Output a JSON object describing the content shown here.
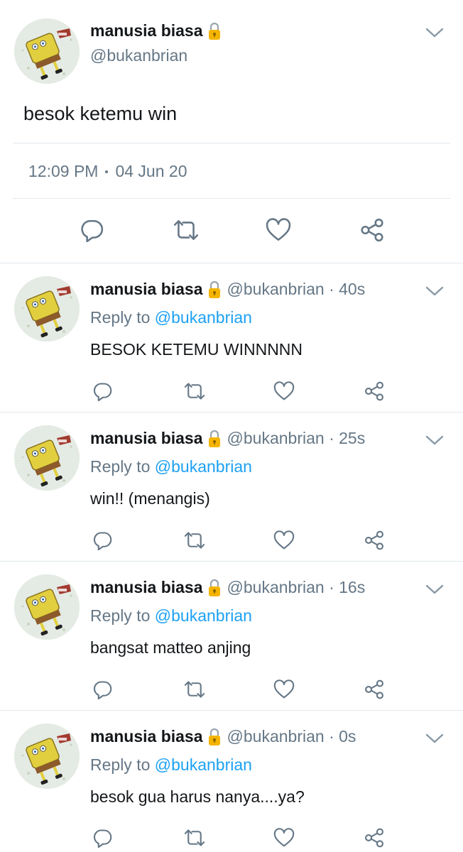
{
  "main_tweet": {
    "display_name": "manusia biasa",
    "handle": "@bukanbrian",
    "text": "besok ketemu win",
    "time": "12:09 PM",
    "date": "04 Jun 20",
    "icons": [
      "lock-icon",
      "chevron-down-icon",
      "reply-icon",
      "retweet-icon",
      "like-icon",
      "share-icon"
    ]
  },
  "replies": [
    {
      "display_name": "manusia biasa",
      "handle": "@bukanbrian · 40s",
      "reply_to_prefix": "Reply to ",
      "reply_to_handle": "@bukanbrian",
      "text": "BESOK KETEMU WINNNNN"
    },
    {
      "display_name": "manusia biasa",
      "handle": "@bukanbrian · 25s",
      "reply_to_prefix": "Reply to ",
      "reply_to_handle": "@bukanbrian",
      "text": "win!! (menangis)"
    },
    {
      "display_name": "manusia biasa",
      "handle": "@bukanbrian · 16s",
      "reply_to_prefix": "Reply to ",
      "reply_to_handle": "@bukanbrian",
      "text": "bangsat matteo anjing"
    },
    {
      "display_name": "manusia biasa",
      "handle": "@bukanbrian · 0s",
      "reply_to_prefix": "Reply to ",
      "reply_to_handle": "@bukanbrian",
      "text": "besok gua harus nanya....ya?"
    }
  ],
  "colors": {
    "text": "#14171a",
    "secondary": "#657786",
    "link": "#1da1f2",
    "divider": "#e1e8ed",
    "lock": "#f5b400"
  }
}
